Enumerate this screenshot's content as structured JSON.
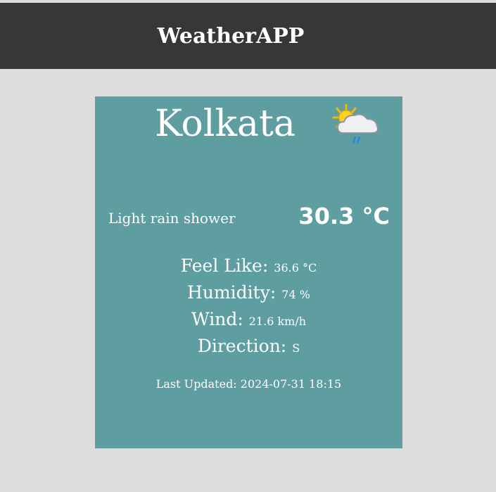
{
  "header": {
    "title": "WeatherAPP"
  },
  "weather": {
    "city": "Kolkata",
    "icon": "partly-cloudy-rain-icon",
    "condition": "Light rain shower",
    "temperature": "30.3 °C",
    "details": [
      {
        "label": "Feel Like:",
        "value": "36.6 °C"
      },
      {
        "label": "Humidity:",
        "value": "74 %"
      },
      {
        "label": "Wind:",
        "value": "21.6 km/h"
      },
      {
        "label": "Direction:",
        "value": "S"
      }
    ],
    "last_updated": "Last Updated: 2024-07-31 18:15"
  },
  "colors": {
    "page_background": "#dddddd",
    "header_background": "#373737",
    "card_background": "#5f9ea0",
    "text": "#ffffff"
  }
}
